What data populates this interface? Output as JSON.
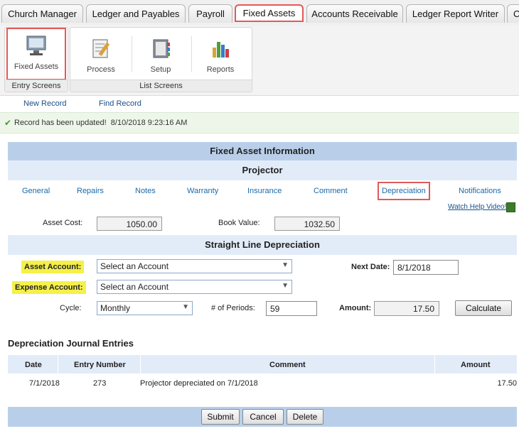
{
  "tabs": [
    "Church Manager",
    "Ledger and Payables",
    "Payroll",
    "Fixed Assets",
    "Accounts Receivable",
    "Ledger Report Writer",
    "C"
  ],
  "ribbon": {
    "entry_label": "Entry Screens",
    "list_label": "List Screens",
    "buttons": [
      "Fixed Assets",
      "Process",
      "Setup",
      "Reports"
    ]
  },
  "actions": {
    "new": "New Record",
    "find": "Find Record"
  },
  "status": {
    "message": "Record has been updated!",
    "timestamp": "8/10/2018 9:23:16 AM"
  },
  "info": {
    "header": "Fixed Asset Information",
    "asset_name": "Projector"
  },
  "subtabs": [
    "General",
    "Repairs",
    "Notes",
    "Warranty",
    "Insurance",
    "Comment",
    "Depreciation",
    "Notifications"
  ],
  "help_link": "Watch Help Video!",
  "costs": {
    "cost_label": "Asset Cost:",
    "cost_value": "1050.00",
    "book_label": "Book Value:",
    "book_value": "1032.50"
  },
  "depreciation": {
    "title": "Straight Line Depreciation",
    "asset_account_label": "Asset Account:",
    "asset_account_value": "Select an Account",
    "expense_account_label": "Expense Account:",
    "expense_account_value": "Select an Account",
    "next_date_label": "Next Date:",
    "next_date_value": "8/1/2018",
    "cycle_label": "Cycle:",
    "cycle_value": "Monthly",
    "periods_label": "# of Periods:",
    "periods_value": "59",
    "amount_label": "Amount:",
    "amount_value": "17.50",
    "calculate": "Calculate"
  },
  "journal": {
    "title": "Depreciation Journal Entries",
    "headers": [
      "Date",
      "Entry Number",
      "Comment",
      "Amount"
    ],
    "rows": [
      {
        "date": "7/1/2018",
        "entry": "273",
        "comment": "Projector depreciated on 7/1/2018",
        "amount": "17.50"
      }
    ]
  },
  "footer": {
    "submit": "Submit",
    "cancel": "Cancel",
    "delete": "Delete"
  }
}
